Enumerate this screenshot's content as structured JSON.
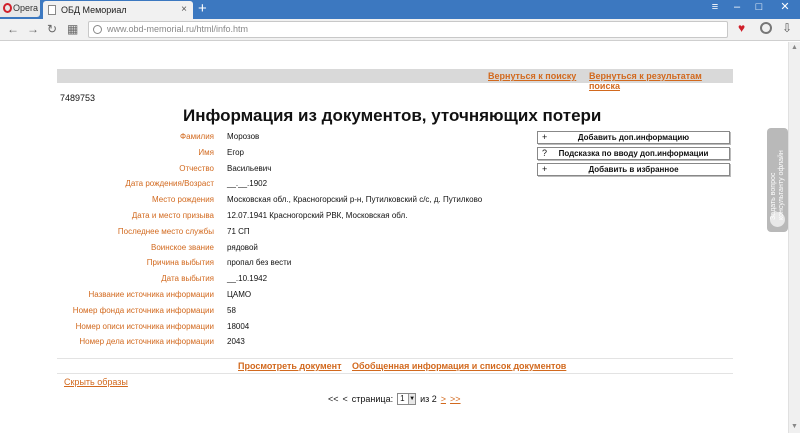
{
  "browser": {
    "opera_label": "Opera",
    "tab_title": "ОБД Мемориал",
    "tab_close": "×",
    "new_tab": "+",
    "url_domain": "www.obd-memorial.ru",
    "url_path": "/html/info.htm"
  },
  "nav": {
    "back_to_search": "Вернуться к поиску",
    "back_to_results": "Вернуться к результатам поиска"
  },
  "record_id": "7489753",
  "title": "Информация из документов, уточняющих потери",
  "fields": [
    {
      "label": "Фамилия",
      "value": "Морозов"
    },
    {
      "label": "Имя",
      "value": "Егор"
    },
    {
      "label": "Отчество",
      "value": "Васильевич"
    },
    {
      "label": "Дата рождения/Возраст",
      "value": "__.__.1902"
    },
    {
      "label": "Место рождения",
      "value": "Московская обл., Красногорский р-н, Путилковский с/с, д. Путилково"
    },
    {
      "label": "Дата и место призыва",
      "value": "12.07.1941 Красногорский РВК, Московская обл."
    },
    {
      "label": "Последнее место службы",
      "value": "71 СП"
    },
    {
      "label": "Воинское звание",
      "value": "рядовой"
    },
    {
      "label": "Причина выбытия",
      "value": "пропал без вести"
    },
    {
      "label": "Дата выбытия",
      "value": "__.10.1942"
    },
    {
      "label": "Название источника информации",
      "value": "ЦАМО"
    },
    {
      "label": "Номер фонда источника информации",
      "value": "58"
    },
    {
      "label": "Номер описи источника информации",
      "value": "18004"
    },
    {
      "label": "Номер дела источника информации",
      "value": "2043"
    }
  ],
  "actions": {
    "add_info": {
      "glyph": "+",
      "label": "Добавить доп.информацию"
    },
    "hint": {
      "glyph": "?",
      "label": "Подсказка по вводу доп.информации"
    },
    "favorites": {
      "glyph": "+",
      "label": "Добавить в избранное"
    }
  },
  "bottom": {
    "view_document": "Просмотреть документ",
    "summary": "Обобщенная информация и список документов",
    "hide_images": "Скрыть образы"
  },
  "pager": {
    "first": "<<",
    "prev": "<",
    "page_label": "страница:",
    "current": "1",
    "of_label": "из 2",
    "next": ">",
    "last": ">>"
  },
  "side_widget": {
    "line1": "Задать вопрос",
    "line2": "консультанту офлайн"
  },
  "colors": {
    "accent": "#d2691e",
    "tabbar": "#3c78c0"
  }
}
